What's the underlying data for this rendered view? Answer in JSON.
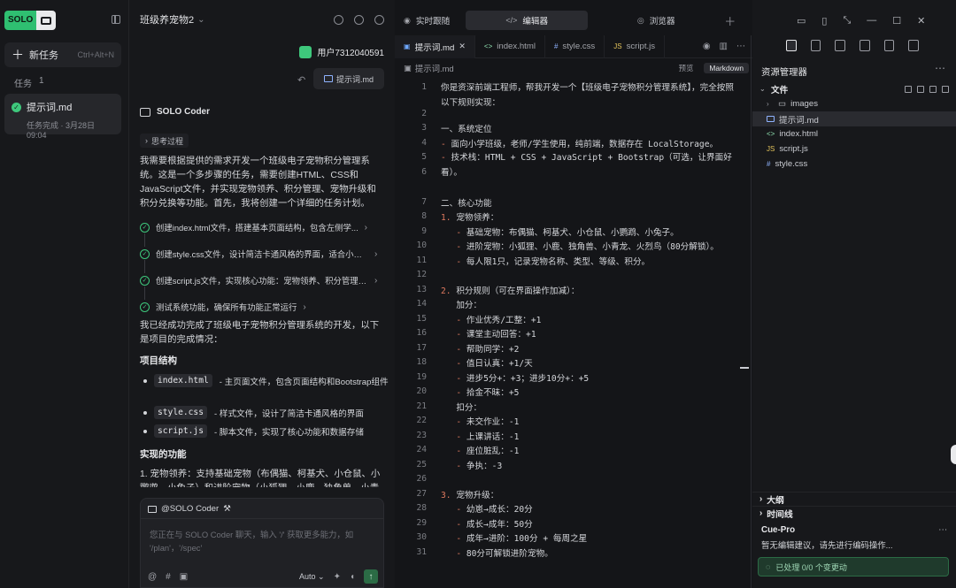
{
  "left": {
    "logo_text": "SOLO",
    "new_task_label": "新任务",
    "new_task_shortcut": "Ctrl+Alt+N",
    "tasks_label": "任务",
    "tasks_count": "1",
    "task": {
      "name": "提示词.md",
      "status": "任务完成 · 3月28日 09:04"
    }
  },
  "chat": {
    "title": "班级养宠物2",
    "user_name": "用户7312040591",
    "attached_file": "提示词.md",
    "agent_name": "SOLO Coder",
    "think_label": "思考过程",
    "intro": "我需要根据提供的需求开发一个班级电子宠物积分管理系统。这是一个多步骤的任务，需要创建HTML、CSS和JavaScript文件，并实现宠物领养、积分管理、宠物升级和积分兑换等功能。首先，我将创建一个详细的任务计划。",
    "steps": [
      "创建index.html文件，搭建基本页面结构，包含左侧学...",
      "创建style.css文件，设计简洁卡通风格的界面，适合小学生...",
      "创建script.js文件，实现核心功能：宠物领养、积分管理、...",
      "测试系统功能，确保所有功能正常运行"
    ],
    "summary": "我已经成功完成了班级电子宠物积分管理系统的开发，以下是项目的完成情况：",
    "structure_heading": "项目结构",
    "files": [
      {
        "name": "index.html",
        "desc": "- 主页面文件，包含页面结构和Bootstrap组件"
      },
      {
        "name": "style.css",
        "desc": "- 样式文件，设计了简洁卡通风格的界面"
      },
      {
        "name": "script.js",
        "desc": "- 脚本文件，实现了核心功能和数据存储"
      }
    ],
    "features_heading": "实现的功能",
    "feature_1": "1. 宠物领养：支持基础宠物（布偶猫、柯基犬、小仓鼠、小鹦鹉、小兔子）和进阶宠物（小狐狸、小鹿、独角兽、小青",
    "input_tag": "@SOLO Coder",
    "input_placeholder": "您正在与 SOLO Coder 聊天，输入 '/' 获取更多能力，如 '/plan'，'/spec'",
    "mode_label": "Auto"
  },
  "editor": {
    "top_tabs": [
      "实时跟随",
      "编辑器",
      "浏览器"
    ],
    "file_tabs": [
      "提示词.md",
      "index.html",
      "style.css",
      "script.js"
    ],
    "breadcrumb": "提示词.md",
    "preview_label": "预览",
    "markdown_label": "Markdown",
    "lines": [
      {
        "n": "1",
        "t": "你是资深前端工程师，帮我开发一个【班级电子宠物积分管理系统】，完全按照以下规则实现："
      },
      {
        "n": "2",
        "t": ""
      },
      {
        "n": "3",
        "t": "一、系统定位"
      },
      {
        "n": "4",
        "t": "- 面向小学班级，老师/学生使用，纯前端，数据存在 LocalStorage。"
      },
      {
        "n": "5",
        "t": "- 技术栈：HTML + CSS + JavaScript + Bootstrap（可选，让界面好看）。"
      },
      {
        "n": "6",
        "t": ""
      },
      {
        "n": "7",
        "t": "二、核心功能"
      },
      {
        "n": "8",
        "t": "1. 宠物领养："
      },
      {
        "n": "9",
        "t": "   - 基础宠物：布偶猫、柯基犬、小仓鼠、小鹦鹉、小兔子。"
      },
      {
        "n": "10",
        "t": "   - 进阶宠物：小狐狸、小鹿、独角兽、小青龙、火烈鸟（80分解锁）。"
      },
      {
        "n": "11",
        "t": "   - 每人限1只，记录宠物名称、类型、等级、积分。"
      },
      {
        "n": "12",
        "t": ""
      },
      {
        "n": "13",
        "t": "2. 积分规则（可在界面操作加减）："
      },
      {
        "n": "14",
        "t": "   加分："
      },
      {
        "n": "15",
        "t": "   - 作业优秀/工整：+1"
      },
      {
        "n": "16",
        "t": "   - 课堂主动回答：+1"
      },
      {
        "n": "17",
        "t": "   - 帮助同学：+2"
      },
      {
        "n": "18",
        "t": "   - 值日认真：+1/天"
      },
      {
        "n": "19",
        "t": "   - 进步5分+：+3；进步10分+：+5"
      },
      {
        "n": "20",
        "t": "   - 拾金不昧：+5"
      },
      {
        "n": "21",
        "t": "   扣分："
      },
      {
        "n": "22",
        "t": "   - 未交作业：-1"
      },
      {
        "n": "23",
        "t": "   - 上课讲话：-1"
      },
      {
        "n": "24",
        "t": "   - 座位脏乱：-1"
      },
      {
        "n": "25",
        "t": "   - 争执：-3"
      },
      {
        "n": "26",
        "t": ""
      },
      {
        "n": "27",
        "t": "3. 宠物升级："
      },
      {
        "n": "28",
        "t": "   - 幼崽→成长：20分"
      },
      {
        "n": "29",
        "t": "   - 成长→成年：50分"
      },
      {
        "n": "30",
        "t": "   - 成年→进阶：100分 + 每周之星"
      },
      {
        "n": "31",
        "t": "   - 80分可解锁进阶宠物。"
      }
    ]
  },
  "right": {
    "explorer_title": "资源管理器",
    "files_root": "文件",
    "tree": [
      {
        "name": "images",
        "kind": "folder"
      },
      {
        "name": "提示词.md",
        "kind": "md"
      },
      {
        "name": "index.html",
        "kind": "html"
      },
      {
        "name": "script.js",
        "kind": "js"
      },
      {
        "name": "style.css",
        "kind": "css"
      }
    ],
    "outline_label": "大纲",
    "timeline_label": "时间线",
    "cue_title": "Cue-Pro",
    "cue_message": "暂无编辑建议，请先进行编码操作...",
    "cue_status": "已处理 0/0 个变更动"
  }
}
